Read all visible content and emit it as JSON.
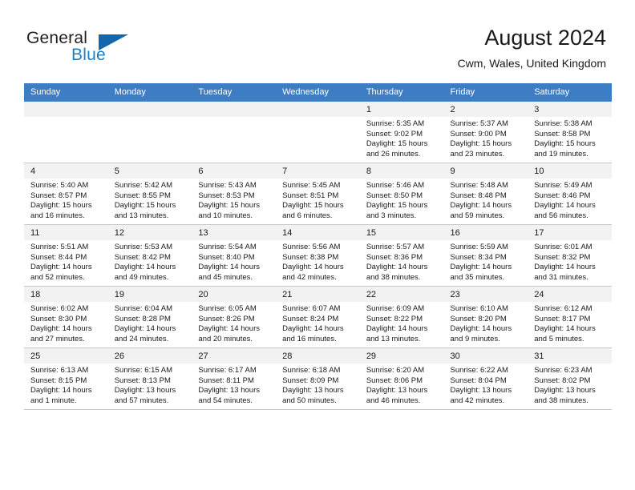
{
  "brand": {
    "name_part1": "General",
    "name_part2": "Blue",
    "flag_icon": "triangle-flag-icon",
    "accent_color": "#1368ad"
  },
  "header": {
    "title": "August 2024",
    "subtitle": "Cwm, Wales, United Kingdom"
  },
  "theme": {
    "header_bg": "#3c7dc4",
    "daynum_bg": "#f2f2f2",
    "grid_line": "#c8c8c8"
  },
  "weekdays": [
    "Sunday",
    "Monday",
    "Tuesday",
    "Wednesday",
    "Thursday",
    "Friday",
    "Saturday"
  ],
  "weeks": [
    [
      {
        "day": "",
        "empty": true
      },
      {
        "day": "",
        "empty": true
      },
      {
        "day": "",
        "empty": true
      },
      {
        "day": "",
        "empty": true
      },
      {
        "day": "1",
        "sunrise": "Sunrise: 5:35 AM",
        "sunset": "Sunset: 9:02 PM",
        "daylight1": "Daylight: 15 hours",
        "daylight2": "and 26 minutes."
      },
      {
        "day": "2",
        "sunrise": "Sunrise: 5:37 AM",
        "sunset": "Sunset: 9:00 PM",
        "daylight1": "Daylight: 15 hours",
        "daylight2": "and 23 minutes."
      },
      {
        "day": "3",
        "sunrise": "Sunrise: 5:38 AM",
        "sunset": "Sunset: 8:58 PM",
        "daylight1": "Daylight: 15 hours",
        "daylight2": "and 19 minutes."
      }
    ],
    [
      {
        "day": "4",
        "sunrise": "Sunrise: 5:40 AM",
        "sunset": "Sunset: 8:57 PM",
        "daylight1": "Daylight: 15 hours",
        "daylight2": "and 16 minutes."
      },
      {
        "day": "5",
        "sunrise": "Sunrise: 5:42 AM",
        "sunset": "Sunset: 8:55 PM",
        "daylight1": "Daylight: 15 hours",
        "daylight2": "and 13 minutes."
      },
      {
        "day": "6",
        "sunrise": "Sunrise: 5:43 AM",
        "sunset": "Sunset: 8:53 PM",
        "daylight1": "Daylight: 15 hours",
        "daylight2": "and 10 minutes."
      },
      {
        "day": "7",
        "sunrise": "Sunrise: 5:45 AM",
        "sunset": "Sunset: 8:51 PM",
        "daylight1": "Daylight: 15 hours",
        "daylight2": "and 6 minutes."
      },
      {
        "day": "8",
        "sunrise": "Sunrise: 5:46 AM",
        "sunset": "Sunset: 8:50 PM",
        "daylight1": "Daylight: 15 hours",
        "daylight2": "and 3 minutes."
      },
      {
        "day": "9",
        "sunrise": "Sunrise: 5:48 AM",
        "sunset": "Sunset: 8:48 PM",
        "daylight1": "Daylight: 14 hours",
        "daylight2": "and 59 minutes."
      },
      {
        "day": "10",
        "sunrise": "Sunrise: 5:49 AM",
        "sunset": "Sunset: 8:46 PM",
        "daylight1": "Daylight: 14 hours",
        "daylight2": "and 56 minutes."
      }
    ],
    [
      {
        "day": "11",
        "sunrise": "Sunrise: 5:51 AM",
        "sunset": "Sunset: 8:44 PM",
        "daylight1": "Daylight: 14 hours",
        "daylight2": "and 52 minutes."
      },
      {
        "day": "12",
        "sunrise": "Sunrise: 5:53 AM",
        "sunset": "Sunset: 8:42 PM",
        "daylight1": "Daylight: 14 hours",
        "daylight2": "and 49 minutes."
      },
      {
        "day": "13",
        "sunrise": "Sunrise: 5:54 AM",
        "sunset": "Sunset: 8:40 PM",
        "daylight1": "Daylight: 14 hours",
        "daylight2": "and 45 minutes."
      },
      {
        "day": "14",
        "sunrise": "Sunrise: 5:56 AM",
        "sunset": "Sunset: 8:38 PM",
        "daylight1": "Daylight: 14 hours",
        "daylight2": "and 42 minutes."
      },
      {
        "day": "15",
        "sunrise": "Sunrise: 5:57 AM",
        "sunset": "Sunset: 8:36 PM",
        "daylight1": "Daylight: 14 hours",
        "daylight2": "and 38 minutes."
      },
      {
        "day": "16",
        "sunrise": "Sunrise: 5:59 AM",
        "sunset": "Sunset: 8:34 PM",
        "daylight1": "Daylight: 14 hours",
        "daylight2": "and 35 minutes."
      },
      {
        "day": "17",
        "sunrise": "Sunrise: 6:01 AM",
        "sunset": "Sunset: 8:32 PM",
        "daylight1": "Daylight: 14 hours",
        "daylight2": "and 31 minutes."
      }
    ],
    [
      {
        "day": "18",
        "sunrise": "Sunrise: 6:02 AM",
        "sunset": "Sunset: 8:30 PM",
        "daylight1": "Daylight: 14 hours",
        "daylight2": "and 27 minutes."
      },
      {
        "day": "19",
        "sunrise": "Sunrise: 6:04 AM",
        "sunset": "Sunset: 8:28 PM",
        "daylight1": "Daylight: 14 hours",
        "daylight2": "and 24 minutes."
      },
      {
        "day": "20",
        "sunrise": "Sunrise: 6:05 AM",
        "sunset": "Sunset: 8:26 PM",
        "daylight1": "Daylight: 14 hours",
        "daylight2": "and 20 minutes."
      },
      {
        "day": "21",
        "sunrise": "Sunrise: 6:07 AM",
        "sunset": "Sunset: 8:24 PM",
        "daylight1": "Daylight: 14 hours",
        "daylight2": "and 16 minutes."
      },
      {
        "day": "22",
        "sunrise": "Sunrise: 6:09 AM",
        "sunset": "Sunset: 8:22 PM",
        "daylight1": "Daylight: 14 hours",
        "daylight2": "and 13 minutes."
      },
      {
        "day": "23",
        "sunrise": "Sunrise: 6:10 AM",
        "sunset": "Sunset: 8:20 PM",
        "daylight1": "Daylight: 14 hours",
        "daylight2": "and 9 minutes."
      },
      {
        "day": "24",
        "sunrise": "Sunrise: 6:12 AM",
        "sunset": "Sunset: 8:17 PM",
        "daylight1": "Daylight: 14 hours",
        "daylight2": "and 5 minutes."
      }
    ],
    [
      {
        "day": "25",
        "sunrise": "Sunrise: 6:13 AM",
        "sunset": "Sunset: 8:15 PM",
        "daylight1": "Daylight: 14 hours",
        "daylight2": "and 1 minute."
      },
      {
        "day": "26",
        "sunrise": "Sunrise: 6:15 AM",
        "sunset": "Sunset: 8:13 PM",
        "daylight1": "Daylight: 13 hours",
        "daylight2": "and 57 minutes."
      },
      {
        "day": "27",
        "sunrise": "Sunrise: 6:17 AM",
        "sunset": "Sunset: 8:11 PM",
        "daylight1": "Daylight: 13 hours",
        "daylight2": "and 54 minutes."
      },
      {
        "day": "28",
        "sunrise": "Sunrise: 6:18 AM",
        "sunset": "Sunset: 8:09 PM",
        "daylight1": "Daylight: 13 hours",
        "daylight2": "and 50 minutes."
      },
      {
        "day": "29",
        "sunrise": "Sunrise: 6:20 AM",
        "sunset": "Sunset: 8:06 PM",
        "daylight1": "Daylight: 13 hours",
        "daylight2": "and 46 minutes."
      },
      {
        "day": "30",
        "sunrise": "Sunrise: 6:22 AM",
        "sunset": "Sunset: 8:04 PM",
        "daylight1": "Daylight: 13 hours",
        "daylight2": "and 42 minutes."
      },
      {
        "day": "31",
        "sunrise": "Sunrise: 6:23 AM",
        "sunset": "Sunset: 8:02 PM",
        "daylight1": "Daylight: 13 hours",
        "daylight2": "and 38 minutes."
      }
    ]
  ]
}
